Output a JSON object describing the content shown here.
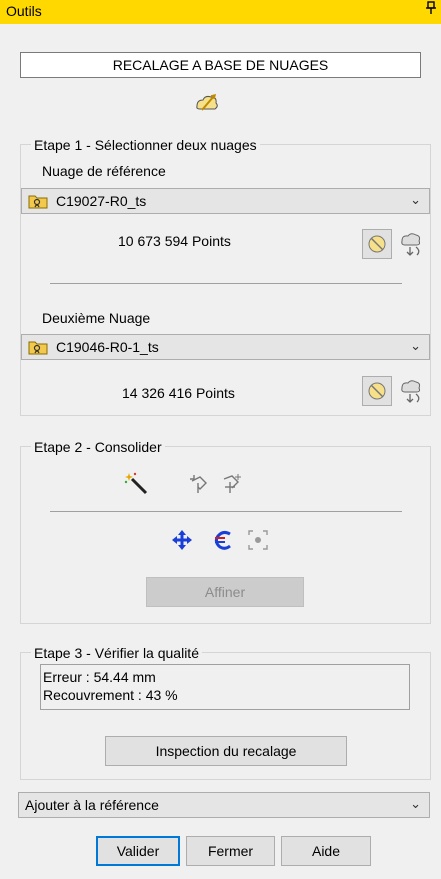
{
  "window": {
    "title": "Outils",
    "pin_glyph": "⫫"
  },
  "header": {
    "title": "RECALAGE A BASE DE NUAGES"
  },
  "step1": {
    "legend": "Etape 1 - Sélectionner deux nuages",
    "ref_label": "Nuage de référence",
    "ref_cloud": "C19027-R0_ts",
    "ref_points": "10 673 594  Points",
    "second_label": "Deuxième Nuage",
    "second_cloud": "C19046-R0-1_ts",
    "second_points": "14 326 416  Points"
  },
  "step2": {
    "legend": "Etape 2 - Consolider",
    "refine_label": "Affiner"
  },
  "step3": {
    "legend": "Etape 3 - Vérifier la qualité",
    "error_line": "Erreur : 54.44 mm",
    "overlap_line": "Recouvrement : 43 %",
    "inspect_label": "Inspection du recalage"
  },
  "bottom": {
    "action_select": "Ajouter à la référence",
    "validate_label": "Valider",
    "close_label": "Fermer",
    "help_label": "Aide"
  },
  "icons": {
    "chevron": "⌄"
  },
  "colors": {
    "titlebar": "#ffd800",
    "accent": "#0078d7"
  }
}
